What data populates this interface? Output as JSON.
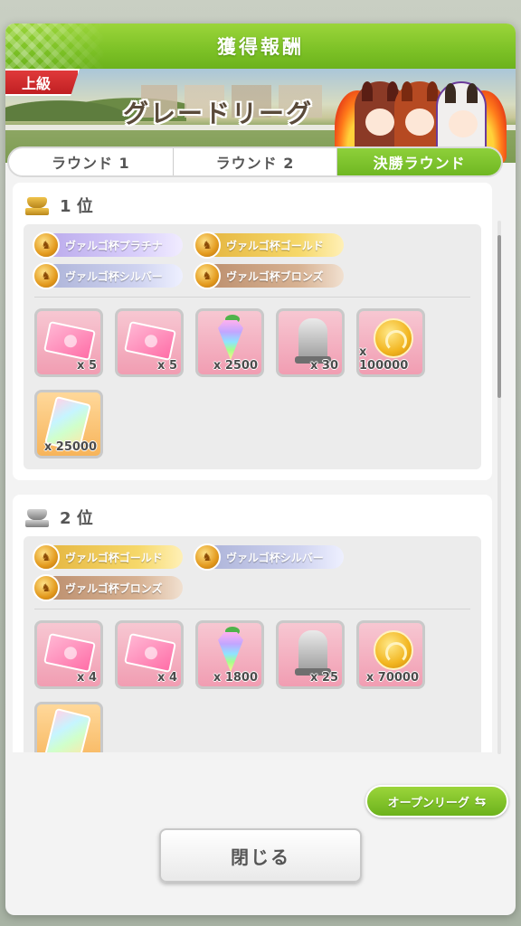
{
  "modal": {
    "title": "獲得報酬",
    "banner": {
      "grade_badge": "上級",
      "league_title": "グレードリーグ"
    },
    "tabs": [
      {
        "label": "ラウンド 1",
        "active": false
      },
      {
        "label": "ラウンド 2",
        "active": false
      },
      {
        "label": "決勝ラウンド",
        "active": true
      }
    ],
    "ranks": [
      {
        "label": "1 位",
        "trophy": "gold-trophy-icon",
        "cups": [
          {
            "label": "ヴァルゴ杯プラチナ",
            "tier": "platinum"
          },
          {
            "label": "ヴァルゴ杯ゴールド",
            "tier": "gold"
          },
          {
            "label": "ヴァルゴ杯シルバー",
            "tier": "silver"
          },
          {
            "label": "ヴァルゴ杯ブロンズ",
            "tier": "bronze"
          }
        ],
        "items": [
          {
            "icon": "ticket-icon",
            "qty": "x 5"
          },
          {
            "icon": "ticket-icon",
            "qty": "x 5"
          },
          {
            "icon": "carrot-crystal-icon",
            "qty": "x 2500"
          },
          {
            "icon": "horse-statue-icon",
            "qty": "x 30"
          },
          {
            "icon": "coin-icon",
            "qty": "x 100000"
          },
          {
            "icon": "rainbow-card-icon",
            "qty": "x 25000"
          }
        ]
      },
      {
        "label": "2 位",
        "trophy": "silver-trophy-icon",
        "cups": [
          {
            "label": "ヴァルゴ杯ゴールド",
            "tier": "gold"
          },
          {
            "label": "ヴァルゴ杯シルバー",
            "tier": "silver"
          },
          {
            "label": "ヴァルゴ杯ブロンズ",
            "tier": "bronze"
          }
        ],
        "items": [
          {
            "icon": "ticket-icon",
            "qty": "x 4"
          },
          {
            "icon": "ticket-icon",
            "qty": "x 4"
          },
          {
            "icon": "carrot-crystal-icon",
            "qty": "x 1800"
          },
          {
            "icon": "horse-statue-icon",
            "qty": "x 25"
          },
          {
            "icon": "coin-icon",
            "qty": "x 70000"
          },
          {
            "icon": "rainbow-card-icon",
            "qty": ""
          }
        ]
      }
    ],
    "open_league_button": "オープンリーグ",
    "close_button": "閉じる"
  }
}
